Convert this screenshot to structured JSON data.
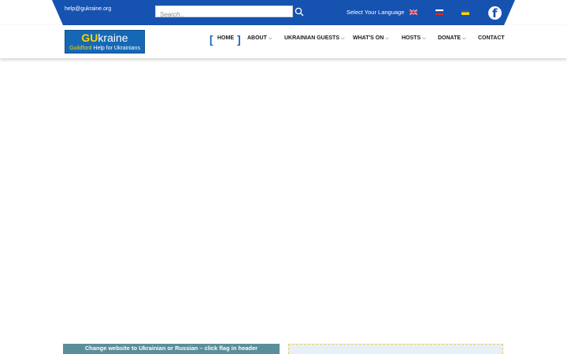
{
  "topbar": {
    "email": "help@gukraine.org",
    "search_placeholder": "Search...",
    "language_label": "Select Your Language",
    "colors": {
      "bar": "#1652b0",
      "header_bg": "#ffffff"
    }
  },
  "logo": {
    "main_prefix": "GU",
    "main_suffix": "kraine",
    "sub_prefix": "Guildford",
    "sub_suffix": " Help for Ukrainians"
  },
  "nav": {
    "items": [
      {
        "label": "HOME"
      },
      {
        "label": "ABOUT"
      },
      {
        "label": "UKRAINIAN GUESTS"
      },
      {
        "label": "WHAT'S ON"
      },
      {
        "label": "HOSTS"
      },
      {
        "label": "DONATE"
      },
      {
        "label": "CONTACT"
      }
    ],
    "chevron": "⌵"
  },
  "icons": {
    "search": "search-icon",
    "facebook": "facebook-icon",
    "flags": [
      "uk-flag-icon",
      "russia-flag-icon",
      "ukraine-flag-icon"
    ]
  },
  "footer_strip": {
    "notice": "Change website  to  Ukrainian or Russian – click flag in header"
  }
}
